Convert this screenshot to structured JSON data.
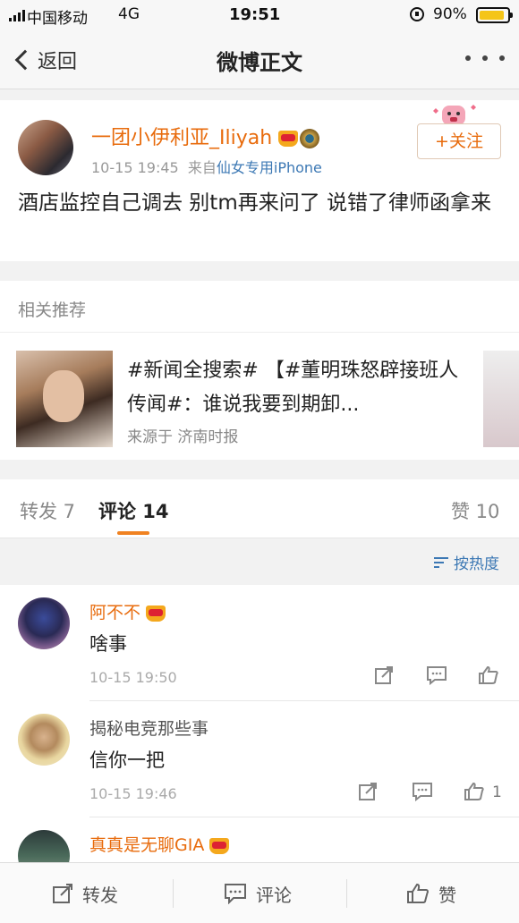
{
  "status": {
    "carrier": "中国移动",
    "network": "4G",
    "time": "19:51",
    "battery": "90%",
    "battery_level": 0.9
  },
  "nav": {
    "back_label": "返回",
    "title": "微博正文"
  },
  "post": {
    "author": "一团小伊利亚_Iliyah",
    "time": "10-15 19:45",
    "source_prefix": "来自",
    "source": "仙女专用iPhone",
    "follow_label": "+关注",
    "text": "酒店监控自己调去 别tm再来问了 说错了律师函拿来"
  },
  "related": {
    "header": "相关推荐",
    "title": "#新闻全搜索# 【#董明珠怒辟接班人传闻#：谁说我要到期卸...",
    "source": "来源于 济南时报"
  },
  "tabs": {
    "repost": "转发 7",
    "comment": "评论 14",
    "like": "赞 10"
  },
  "sort_label": "按热度",
  "comments": [
    {
      "name": "阿不不",
      "vip": true,
      "text": "啥事",
      "time": "10-15 19:50",
      "likes": ""
    },
    {
      "name": "揭秘电竞那些事",
      "vip": false,
      "text": "信你一把",
      "time": "10-15 19:46",
      "likes": "1"
    },
    {
      "name": "真真是无聊GIA",
      "vip": true,
      "text": "",
      "time": "",
      "likes": ""
    }
  ],
  "bottom": {
    "repost": "转发",
    "comment": "评论",
    "like": "赞"
  },
  "colors": {
    "accent": "#e86b0c",
    "link": "#3c78b4",
    "tab_indicator": "#f08221"
  }
}
